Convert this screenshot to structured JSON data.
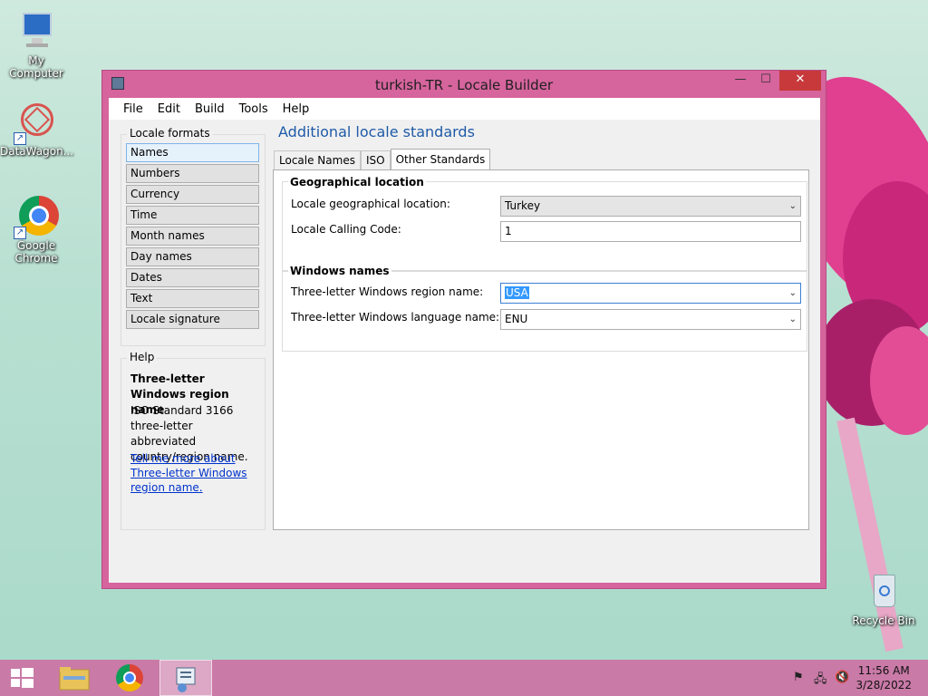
{
  "desktop": {
    "icons": [
      {
        "label": "My Computer"
      },
      {
        "label": "DataWagon..."
      },
      {
        "label": "Google Chrome"
      },
      {
        "label": "Recycle Bin"
      }
    ]
  },
  "window": {
    "title": "turkish-TR - Locale Builder",
    "controls": {
      "minimize": "—",
      "maximize": "☐",
      "close": "✕"
    }
  },
  "menu": [
    "File",
    "Edit",
    "Build",
    "Tools",
    "Help"
  ],
  "locale_formats": {
    "label": "Locale formats",
    "items": [
      "Names",
      "Numbers",
      "Currency",
      "Time",
      "Month names",
      "Day names",
      "Dates",
      "Text",
      "Locale signature"
    ],
    "active_index": 0
  },
  "help": {
    "label": "Help",
    "title": "Three-letter Windows region name",
    "text": "ISO Standard 3166 three-letter abbreviated country/region name.",
    "link": "Tell me more about Three-letter Windows region name."
  },
  "main": {
    "heading": "Additional locale standards",
    "tabs": [
      "Locale Names",
      "ISO",
      "Other Standards"
    ],
    "active_tab": 2,
    "geographical": {
      "label": "Geographical location",
      "location_label": "Locale geographical location:",
      "location_value": "Turkey",
      "calling_code_label": "Locale Calling Code:",
      "calling_code_value": "1"
    },
    "windows_names": {
      "label": "Windows names",
      "region_label": "Three-letter Windows region name:",
      "region_value": "USA",
      "language_label": "Three-letter Windows language name:",
      "language_value": "ENU"
    }
  },
  "taskbar": {
    "time": "11:56 AM",
    "date": "3/28/2022"
  },
  "colors": {
    "window_frame": "#d6649d",
    "close_button": "#c7393b",
    "heading": "#1e5aa8",
    "taskbar": "#c97aa7"
  }
}
